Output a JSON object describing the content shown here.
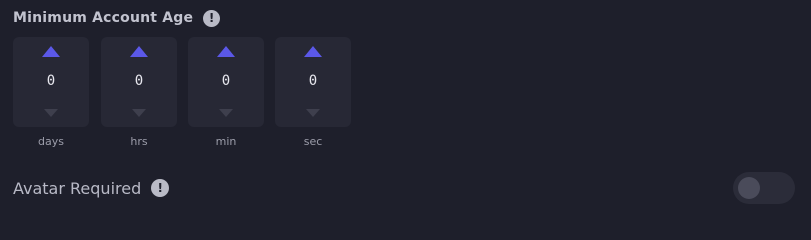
{
  "minimum_account_age": {
    "title": "Minimum Account Age",
    "info_icon": "info-icon",
    "fields": [
      {
        "unit": "days",
        "value": "0"
      },
      {
        "unit": "hrs",
        "value": "0"
      },
      {
        "unit": "min",
        "value": "0"
      },
      {
        "unit": "sec",
        "value": "0"
      }
    ]
  },
  "avatar_required": {
    "title": "Avatar Required",
    "info_icon": "info-icon",
    "toggle_on": false
  },
  "colors": {
    "background": "#1e1f2b",
    "spinner_bg": "#272835",
    "accent_arrow": "#5b58e8",
    "disabled_arrow": "#3e3f4d"
  }
}
